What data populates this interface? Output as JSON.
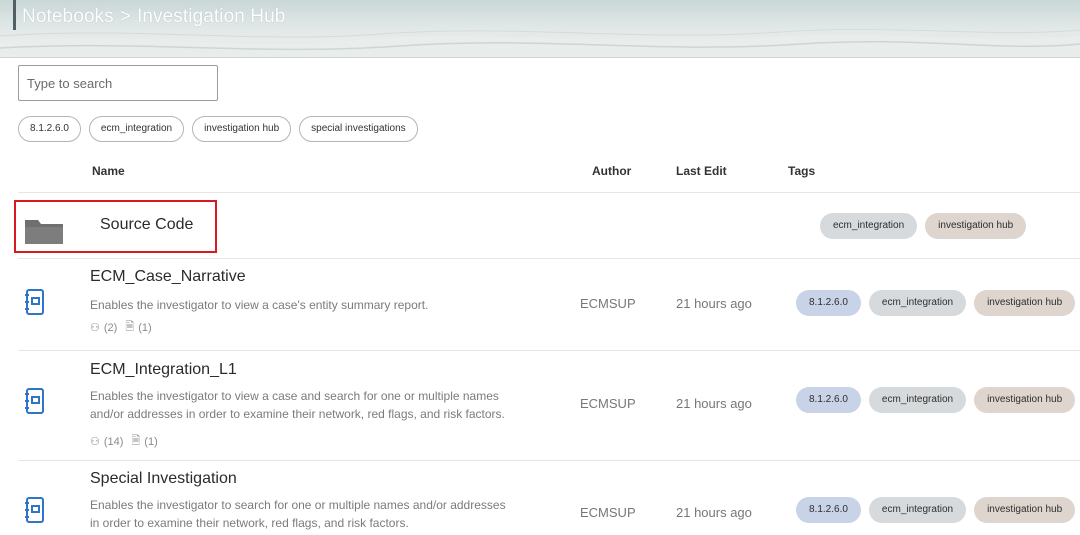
{
  "header": {
    "breadcrumb_root": "Notebooks",
    "breadcrumb_separator": ">",
    "breadcrumb_current": "Investigation Hub"
  },
  "search": {
    "placeholder": "Type to search",
    "value": ""
  },
  "filter_tags": [
    "8.1.2.6.0",
    "ecm_integration",
    "investigation hub",
    "special investigations"
  ],
  "columns": {
    "name": "Name",
    "author": "Author",
    "last_edit": "Last Edit",
    "tags": "Tags"
  },
  "folder": {
    "name": "Source Code",
    "icon": "folder-icon",
    "tags": [
      "ecm_integration",
      "investigation hub"
    ]
  },
  "notebooks": [
    {
      "name": "ECM_Case_Narrative",
      "description_lines": [
        "Enables the investigator to view a case's entity summary report."
      ],
      "users_count": "(2)",
      "docs_count": "(1)",
      "author": "ECMSUP",
      "last_edit": "21 hours ago",
      "tags": [
        "8.1.2.6.0",
        "ecm_integration",
        "investigation hub"
      ]
    },
    {
      "name": "ECM_Integration_L1",
      "description_lines": [
        "Enables the investigator to view a case and search for one or multiple names",
        "and/or addresses in order to examine their network, red flags, and risk factors."
      ],
      "users_count": "(14)",
      "docs_count": "(1)",
      "author": "ECMSUP",
      "last_edit": "21 hours ago",
      "tags": [
        "8.1.2.6.0",
        "ecm_integration",
        "investigation hub"
      ]
    },
    {
      "name": "Special Investigation",
      "description_lines": [
        "Enables the investigator to search for one or multiple names and/or addresses",
        "in order to examine their network, red flags, and risk factors."
      ],
      "author": "ECMSUP",
      "last_edit": "21 hours ago",
      "tags": [
        "8.1.2.6.0",
        "ecm_integration",
        "investigation hub"
      ]
    }
  ],
  "colors": {
    "highlight": "#d71920",
    "tag_version": "#c9d3e8",
    "tag_ecm": "#d6dadd",
    "tag_hub": "#ddd5ce"
  }
}
